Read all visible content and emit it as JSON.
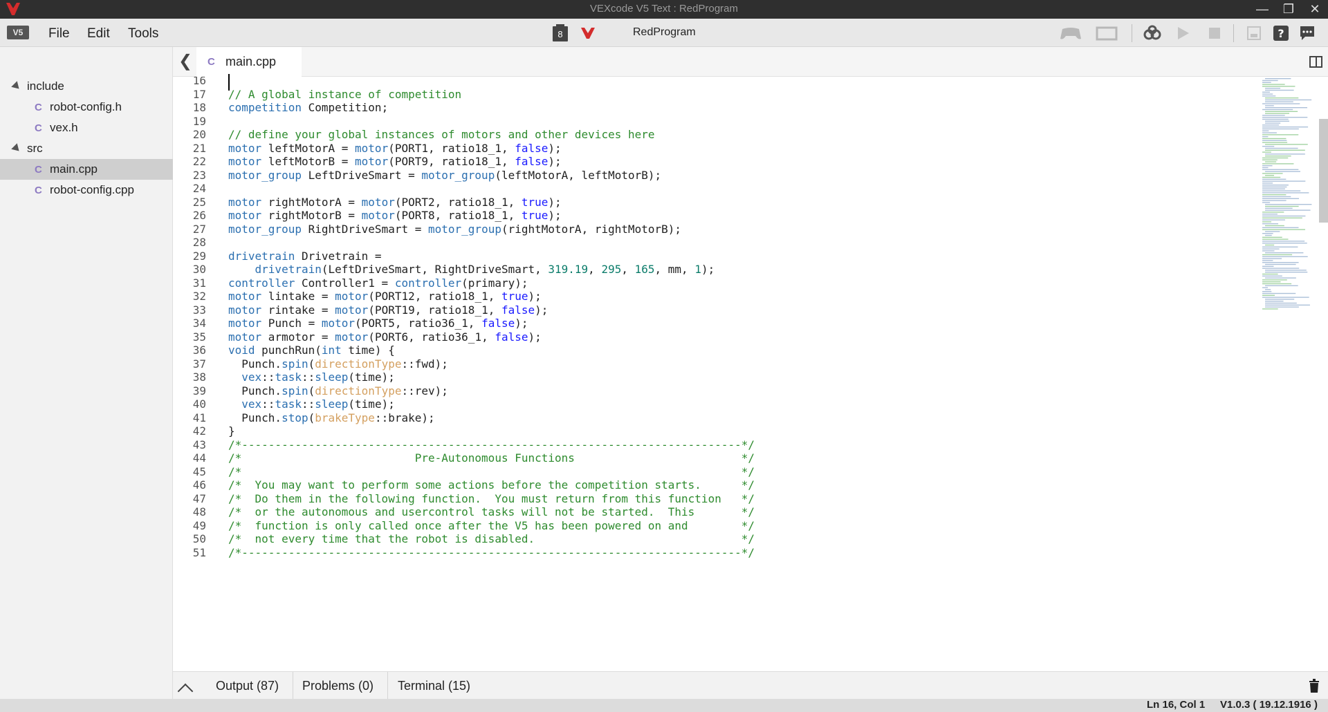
{
  "window": {
    "title": "VEXcode V5 Text : RedProgram"
  },
  "menu": {
    "logo": "V5",
    "file": "File",
    "edit": "Edit",
    "tools": "Tools"
  },
  "toolbar": {
    "slot": "8",
    "project_name": "RedProgram"
  },
  "sidebar": {
    "items": [
      {
        "label": "include",
        "type": "folder"
      },
      {
        "label": "robot-config.h",
        "type": "file"
      },
      {
        "label": "vex.h",
        "type": "file"
      },
      {
        "label": "src",
        "type": "folder"
      },
      {
        "label": "main.cpp",
        "type": "file",
        "selected": true
      },
      {
        "label": "robot-config.cpp",
        "type": "file"
      }
    ]
  },
  "tab": {
    "label": "main.cpp",
    "icon": "C"
  },
  "editor": {
    "lines": [
      {
        "n": "16",
        "t": ""
      },
      {
        "n": "17",
        "t": "// A global instance of competition"
      },
      {
        "n": "18",
        "t": "competition Competition;"
      },
      {
        "n": "19",
        "t": ""
      },
      {
        "n": "20",
        "t": "// define your global instances of motors and other devices here"
      },
      {
        "n": "21",
        "t": "motor leftMotorA = motor(PORT1, ratio18_1, false);"
      },
      {
        "n": "22",
        "t": "motor leftMotorB = motor(PORT9, ratio18_1, false);"
      },
      {
        "n": "23",
        "t": "motor_group LeftDriveSmart = motor_group(leftMotorA, leftMotorB);"
      },
      {
        "n": "24",
        "t": ""
      },
      {
        "n": "25",
        "t": "motor rightMotorA = motor(PORT2, ratio18_1, true);"
      },
      {
        "n": "26",
        "t": "motor rightMotorB = motor(PORT8, ratio18_1, true);"
      },
      {
        "n": "27",
        "t": "motor_group RightDriveSmart = motor_group(rightMotorA, rightMotorB);"
      },
      {
        "n": "28",
        "t": ""
      },
      {
        "n": "29",
        "t": "drivetrain Drivetrain ="
      },
      {
        "n": "30",
        "t": "    drivetrain(LeftDriveSmart, RightDriveSmart, 319.19, 295, 165, mm, 1);"
      },
      {
        "n": "31",
        "t": "controller Controller1 = controller(primary);"
      },
      {
        "n": "32",
        "t": "motor lintake = motor(PORT12, ratio18_1, true);"
      },
      {
        "n": "33",
        "t": "motor rintake = motor(PORT19, ratio18_1, false);"
      },
      {
        "n": "34",
        "t": "motor Punch = motor(PORT5, ratio36_1, false);"
      },
      {
        "n": "35",
        "t": "motor armotor = motor(PORT6, ratio36_1, false);"
      },
      {
        "n": "36",
        "t": "void punchRun(int time) {"
      },
      {
        "n": "37",
        "t": "  Punch.spin(directionType::fwd);"
      },
      {
        "n": "38",
        "t": "  vex::task::sleep(time);"
      },
      {
        "n": "39",
        "t": "  Punch.spin(directionType::rev);"
      },
      {
        "n": "40",
        "t": "  vex::task::sleep(time);"
      },
      {
        "n": "41",
        "t": "  Punch.stop(brakeType::brake);"
      },
      {
        "n": "42",
        "t": "}"
      },
      {
        "n": "43",
        "t": "/*---------------------------------------------------------------------------*/"
      },
      {
        "n": "44",
        "t": "/*                          Pre-Autonomous Functions                         */"
      },
      {
        "n": "45",
        "t": "/*                                                                           */"
      },
      {
        "n": "46",
        "t": "/*  You may want to perform some actions before the competition starts.      */"
      },
      {
        "n": "47",
        "t": "/*  Do them in the following function.  You must return from this function   */"
      },
      {
        "n": "48",
        "t": "/*  or the autonomous and usercontrol tasks will not be started.  This       */"
      },
      {
        "n": "49",
        "t": "/*  function is only called once after the V5 has been powered on and        */"
      },
      {
        "n": "50",
        "t": "/*  not every time that the robot is disabled.                               */"
      },
      {
        "n": "51",
        "t": "/*---------------------------------------------------------------------------*/"
      }
    ]
  },
  "bottom": {
    "output": "Output (87)",
    "problems": "Problems (0)",
    "terminal": "Terminal (15)"
  },
  "status": {
    "position": "Ln 16, Col 1",
    "version": "V1.0.3 ( 19.12.1916 )"
  },
  "colors": {
    "keyword": "#2b6fb0",
    "comment": "#2e8b2e",
    "literal": "#1a1aff",
    "number": "#0b7c6a",
    "type": "#d4a060"
  }
}
